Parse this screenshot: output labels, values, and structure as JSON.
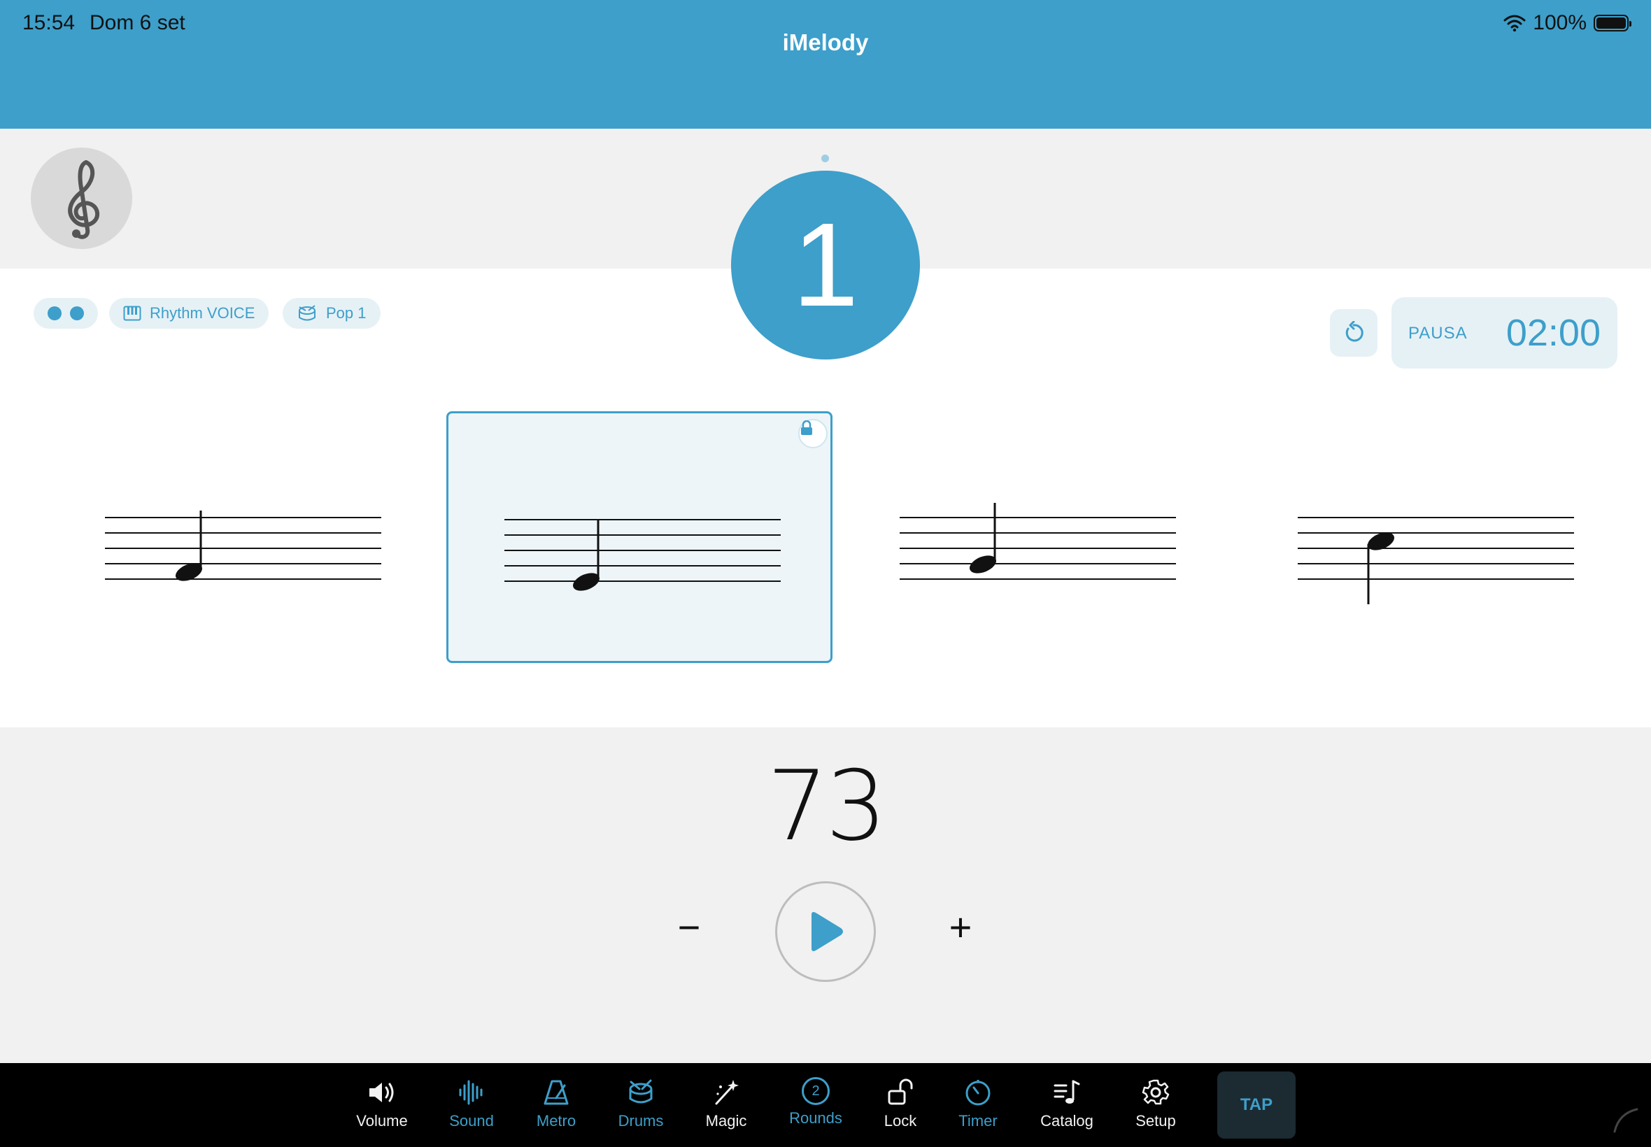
{
  "status_bar": {
    "time": "15:54",
    "date": "Dom 6 set",
    "battery": "100%"
  },
  "header": {
    "title": "iMelody"
  },
  "beat": {
    "number": "1"
  },
  "chips": {
    "instrument": "Rhythm VOICE",
    "drums": "Pop 1"
  },
  "timer": {
    "label": "PAUSA",
    "value": "02:00"
  },
  "measures": [
    {
      "note": "G4",
      "stem": "up",
      "selected": false,
      "locked": false
    },
    {
      "note": "F4",
      "stem": "up",
      "selected": true,
      "locked": true
    },
    {
      "note": "A4",
      "stem": "up",
      "selected": false,
      "locked": false
    },
    {
      "note": "D5",
      "stem": "down",
      "selected": false,
      "locked": false
    }
  ],
  "tempo": {
    "bpm": "73",
    "minus_label": "−",
    "plus_label": "+"
  },
  "toolbar": {
    "items": [
      {
        "label": "Volume",
        "icon": "speaker-icon",
        "color": "#f2f2f2"
      },
      {
        "label": "Sound",
        "icon": "waveform-icon",
        "color": "#3d9fca"
      },
      {
        "label": "Metro",
        "icon": "metronome-icon",
        "color": "#3d9fca"
      },
      {
        "label": "Drums",
        "icon": "drum-icon",
        "color": "#3d9fca"
      },
      {
        "label": "Magic",
        "icon": "magic-wand-icon",
        "color": "#f2f2f2"
      },
      {
        "label": "Rounds",
        "icon": "rounds-counter-icon",
        "color": "#3d9fca"
      },
      {
        "label": "Lock",
        "icon": "unlock-icon",
        "color": "#f2f2f2"
      },
      {
        "label": "Timer",
        "icon": "timer-icon",
        "color": "#3d9fca"
      },
      {
        "label": "Catalog",
        "icon": "music-list-icon",
        "color": "#f2f2f2"
      },
      {
        "label": "Setup",
        "icon": "gear-icon",
        "color": "#f2f2f2"
      }
    ],
    "rounds_count": "2",
    "tap_label": "TAP"
  },
  "colors": {
    "accent": "#3d9fca",
    "header": "#3d9fca",
    "toolbar": "#000000"
  }
}
